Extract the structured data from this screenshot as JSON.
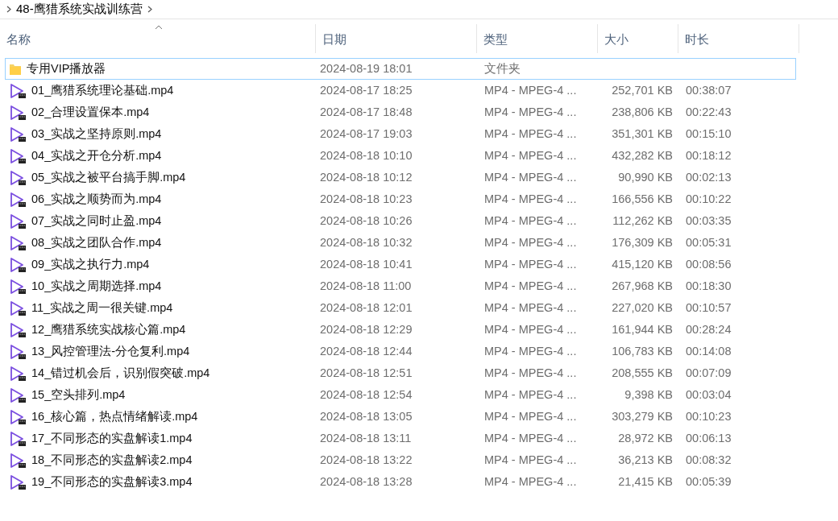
{
  "breadcrumb": {
    "items": [
      "48-鹰猎系统实战训练营"
    ]
  },
  "columns": [
    {
      "label": "名称",
      "sorted": true
    },
    {
      "label": "日期",
      "sorted": false
    },
    {
      "label": "类型",
      "sorted": false
    },
    {
      "label": "大小",
      "sorted": false
    },
    {
      "label": "时长",
      "sorted": false
    }
  ],
  "rows": [
    {
      "kind": "folder",
      "focused": true,
      "name": "专用VIP播放器",
      "date": "2024-08-19 18:01",
      "type": "文件夹"
    },
    {
      "kind": "video",
      "focused": false,
      "name": "01_鹰猎系统理论基础.mp4",
      "date": "2024-08-17 18:25",
      "type": "MP4 - MPEG-4 ...",
      "size": "252,701 KB",
      "duration": "00:38:07"
    },
    {
      "kind": "video",
      "focused": false,
      "name": "02_合理设置保本.mp4",
      "date": "2024-08-17 18:48",
      "type": "MP4 - MPEG-4 ...",
      "size": "238,806 KB",
      "duration": "00:22:43"
    },
    {
      "kind": "video",
      "focused": false,
      "name": "03_实战之坚持原则.mp4",
      "date": "2024-08-17 19:03",
      "type": "MP4 - MPEG-4 ...",
      "size": "351,301 KB",
      "duration": "00:15:10"
    },
    {
      "kind": "video",
      "focused": false,
      "name": "04_实战之开仓分析.mp4",
      "date": "2024-08-18 10:10",
      "type": "MP4 - MPEG-4 ...",
      "size": "432,282 KB",
      "duration": "00:18:12"
    },
    {
      "kind": "video",
      "focused": false,
      "name": "05_实战之被平台搞手脚.mp4",
      "date": "2024-08-18 10:12",
      "type": "MP4 - MPEG-4 ...",
      "size": "90,990 KB",
      "duration": "00:02:13"
    },
    {
      "kind": "video",
      "focused": false,
      "name": "06_实战之顺势而为.mp4",
      "date": "2024-08-18 10:23",
      "type": "MP4 - MPEG-4 ...",
      "size": "166,556 KB",
      "duration": "00:10:22"
    },
    {
      "kind": "video",
      "focused": false,
      "name": "07_实战之同时止盈.mp4",
      "date": "2024-08-18 10:26",
      "type": "MP4 - MPEG-4 ...",
      "size": "112,262 KB",
      "duration": "00:03:35"
    },
    {
      "kind": "video",
      "focused": false,
      "name": "08_实战之团队合作.mp4",
      "date": "2024-08-18 10:32",
      "type": "MP4 - MPEG-4 ...",
      "size": "176,309 KB",
      "duration": "00:05:31"
    },
    {
      "kind": "video",
      "focused": false,
      "name": "09_实战之执行力.mp4",
      "date": "2024-08-18 10:41",
      "type": "MP4 - MPEG-4 ...",
      "size": "415,120 KB",
      "duration": "00:08:56"
    },
    {
      "kind": "video",
      "focused": false,
      "name": "10_实战之周期选择.mp4",
      "date": "2024-08-18 11:00",
      "type": "MP4 - MPEG-4 ...",
      "size": "267,968 KB",
      "duration": "00:18:30"
    },
    {
      "kind": "video",
      "focused": false,
      "name": "11_实战之周一很关键.mp4",
      "date": "2024-08-18 12:01",
      "type": "MP4 - MPEG-4 ...",
      "size": "227,020 KB",
      "duration": "00:10:57"
    },
    {
      "kind": "video",
      "focused": false,
      "name": "12_鹰猎系统实战核心篇.mp4",
      "date": "2024-08-18 12:29",
      "type": "MP4 - MPEG-4 ...",
      "size": "161,944 KB",
      "duration": "00:28:24"
    },
    {
      "kind": "video",
      "focused": false,
      "name": "13_风控管理法-分仓复利.mp4",
      "date": "2024-08-18 12:44",
      "type": "MP4 - MPEG-4 ...",
      "size": "106,783 KB",
      "duration": "00:14:08"
    },
    {
      "kind": "video",
      "focused": false,
      "name": "14_错过机会后，识别假突破.mp4",
      "date": "2024-08-18 12:51",
      "type": "MP4 - MPEG-4 ...",
      "size": "208,555 KB",
      "duration": "00:07:09"
    },
    {
      "kind": "video",
      "focused": false,
      "name": "15_空头排列.mp4",
      "date": "2024-08-18 12:54",
      "type": "MP4 - MPEG-4 ...",
      "size": "9,398 KB",
      "duration": "00:03:04"
    },
    {
      "kind": "video",
      "focused": false,
      "name": "16_核心篇，热点情绪解读.mp4",
      "date": "2024-08-18 13:05",
      "type": "MP4 - MPEG-4 ...",
      "size": "303,279 KB",
      "duration": "00:10:23"
    },
    {
      "kind": "video",
      "focused": false,
      "name": "17_不同形态的实盘解读1.mp4",
      "date": "2024-08-18 13:11",
      "type": "MP4 - MPEG-4 ...",
      "size": "28,972 KB",
      "duration": "00:06:13"
    },
    {
      "kind": "video",
      "focused": false,
      "name": "18_不同形态的实盘解读2.mp4",
      "date": "2024-08-18 13:22",
      "type": "MP4 - MPEG-4 ...",
      "size": "36,213 KB",
      "duration": "00:08:32"
    },
    {
      "kind": "video",
      "focused": false,
      "name": "19_不同形态的实盘解读3.mp4",
      "date": "2024-08-18 13:28",
      "type": "MP4 - MPEG-4 ...",
      "size": "21,415 KB",
      "duration": "00:05:39"
    }
  ]
}
